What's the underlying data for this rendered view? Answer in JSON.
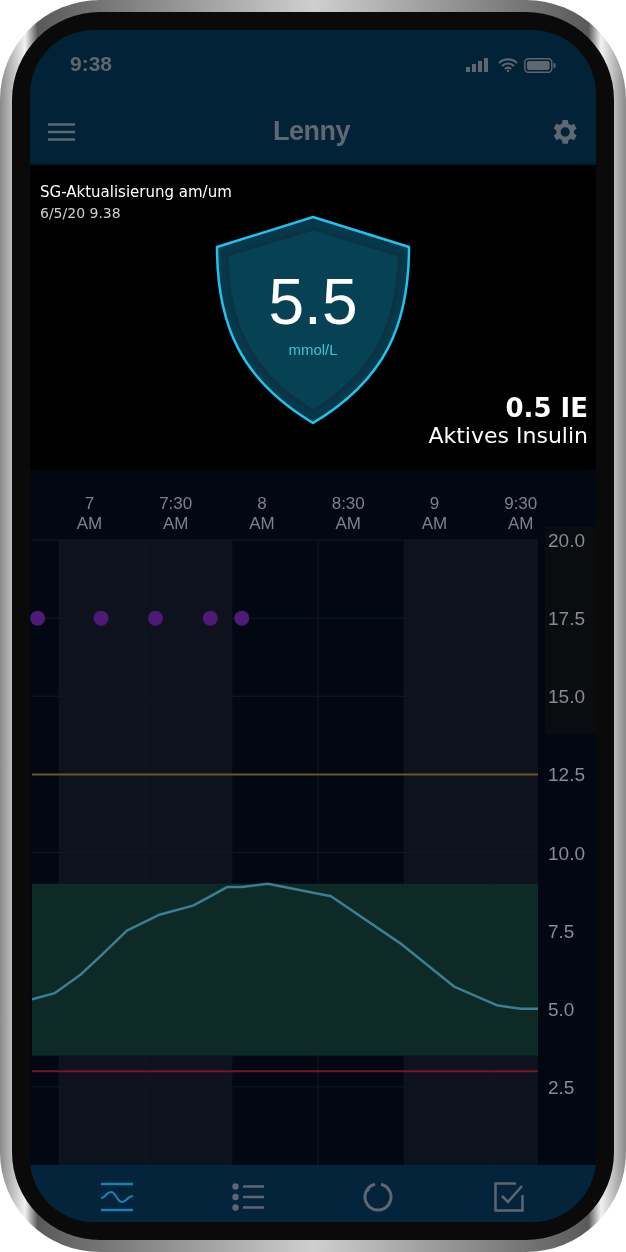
{
  "status_bar": {
    "time": "9:38"
  },
  "header": {
    "title": "Lenny"
  },
  "reading": {
    "label": "SG-Aktualisierung am/um",
    "timestamp": "6/5/20 9.38",
    "value": "5.5",
    "unit": "mmol/L"
  },
  "active_insulin": {
    "value": "0.5 IE",
    "label": "Aktives Insulin"
  },
  "chart": {
    "chart_data": {
      "type": "line",
      "xlim": [
        6.667,
        9.6
      ],
      "ylim": [
        0,
        20
      ],
      "xticks": [
        {
          "value": 7,
          "label": "7 AM"
        },
        {
          "value": 7.5,
          "label": "7:30 AM"
        },
        {
          "value": 8,
          "label": "8 AM"
        },
        {
          "value": 8.5,
          "label": "8:30 AM"
        },
        {
          "value": 9,
          "label": "9 AM"
        },
        {
          "value": 9.5,
          "label": "9:30 AM"
        }
      ],
      "yticks": [
        {
          "value": 20,
          "label": "20.0"
        },
        {
          "value": 17.5,
          "label": "17.5"
        },
        {
          "value": 15,
          "label": "15.0"
        },
        {
          "value": 12.5,
          "label": "12.5"
        },
        {
          "value": 10,
          "label": "10.0"
        },
        {
          "value": 7.5,
          "label": "7.5"
        },
        {
          "value": 5,
          "label": "5.0"
        },
        {
          "value": 2.5,
          "label": "2.5"
        }
      ],
      "grid": true,
      "x": [
        6.667,
        6.7,
        6.8,
        6.95,
        7.067,
        7.217,
        7.383,
        7.4,
        7.6,
        7.7,
        7.8,
        7.883,
        8.033,
        8.4,
        8.8,
        9.117,
        9.367,
        9.5,
        9.6
      ],
      "series": [
        {
          "color": "#3a7f93",
          "values": [
            5.3,
            5.35,
            5.5,
            6.1,
            6.7,
            7.5,
            7.95,
            8.0,
            8.3,
            8.6,
            8.9,
            8.9,
            9.0,
            8.6,
            7.1,
            5.7,
            5.1,
            5.0,
            5.0
          ]
        },
        {
          "type": "scatter",
          "color": "#4e1a78",
          "values": [
            null,
            17.5,
            null,
            null,
            17.5,
            null,
            17.5,
            null,
            null,
            17.5,
            null,
            17.5,
            null,
            null,
            null,
            null,
            null,
            null,
            null
          ]
        }
      ],
      "bands": [
        {
          "axis": "x",
          "from": 6.825,
          "to": 7.825,
          "color": "#0d121d"
        },
        {
          "axis": "x",
          "from": 8.825,
          "to": 9.6,
          "color": "#0d121d"
        },
        {
          "axis": "y",
          "from": 3.5,
          "to": 9.0,
          "color": "#0d2a26"
        }
      ],
      "ref_lines": [
        {
          "axis": "y",
          "value": 12.5,
          "color": "#6b5428"
        },
        {
          "axis": "y",
          "value": 3.0,
          "color": "#7a1420"
        }
      ]
    }
  },
  "nav": [
    {
      "kind": "graph",
      "selected": true
    },
    {
      "kind": "list",
      "selected": false
    },
    {
      "kind": "status",
      "selected": false
    },
    {
      "kind": "checklist",
      "selected": false
    }
  ]
}
